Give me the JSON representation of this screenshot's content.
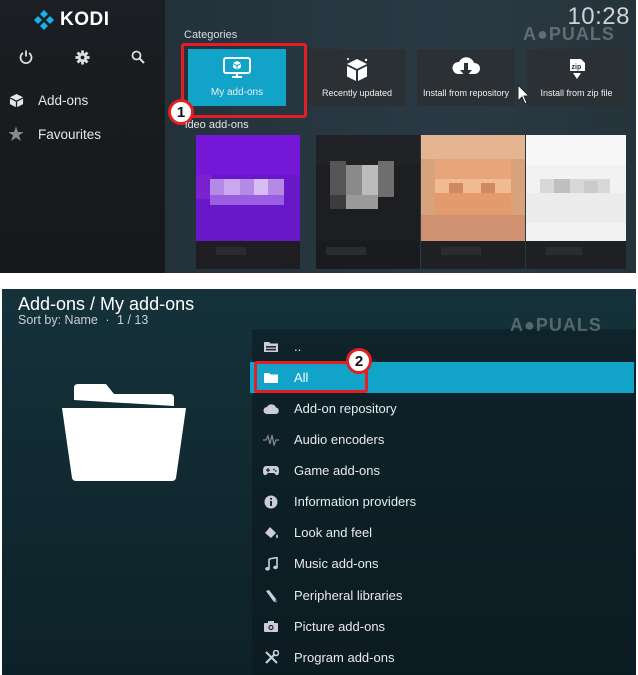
{
  "top": {
    "app_name": "KODI",
    "clock": "10:28",
    "system_icons": [
      "power-icon",
      "gear-icon",
      "search-icon"
    ],
    "menu": [
      {
        "label": "Add-ons",
        "icon": "box-icon"
      },
      {
        "label": "Favourites",
        "icon": "star-icon"
      }
    ],
    "categories_label": "Categories",
    "tiles": [
      {
        "label": "My add-ons",
        "icon": "monitor-box-icon",
        "selected": true
      },
      {
        "label": "Recently updated",
        "icon": "box-icon"
      },
      {
        "label": "Install from repository",
        "icon": "cloud-download-icon"
      },
      {
        "label": "Install from zip file",
        "icon": "zip-icon"
      }
    ],
    "video_label": "ideo add-ons",
    "step_badge": "1"
  },
  "bottom": {
    "title": "Add-ons / My add-ons",
    "sort": "Sort by: Name",
    "count": "1 / 13",
    "step_badge": "2",
    "items": [
      {
        "label": "..",
        "icon": "folder-up-icon"
      },
      {
        "label": "All",
        "icon": "folder-icon",
        "selected": true
      },
      {
        "label": "Add-on repository",
        "icon": "cloud-icon"
      },
      {
        "label": "Audio encoders",
        "icon": "audio-wave-icon"
      },
      {
        "label": "Game add-ons",
        "icon": "gamepad-icon"
      },
      {
        "label": "Information providers",
        "icon": "info-icon"
      },
      {
        "label": "Look and feel",
        "icon": "paint-bucket-icon"
      },
      {
        "label": "Music add-ons",
        "icon": "music-note-icon"
      },
      {
        "label": "Peripheral libraries",
        "icon": "pen-icon"
      },
      {
        "label": "Picture add-ons",
        "icon": "camera-icon"
      },
      {
        "label": "Program add-ons",
        "icon": "tools-icon"
      }
    ]
  },
  "colors": {
    "accent": "#12a3c9",
    "highlight": "#e31e24",
    "kodi_blue": "#17b2e7"
  }
}
